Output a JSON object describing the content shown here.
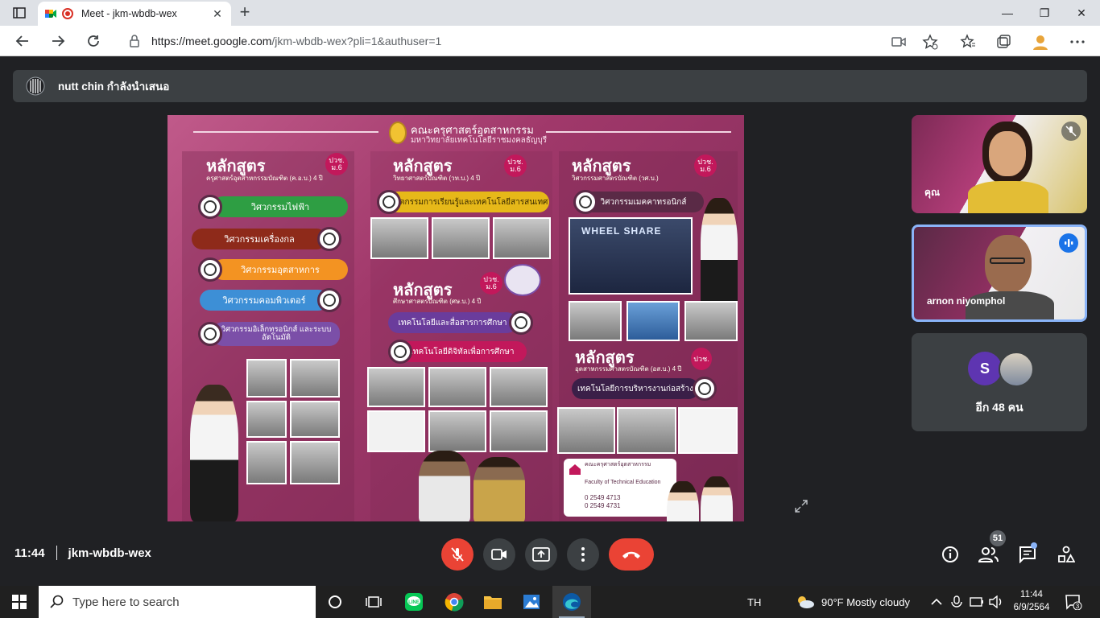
{
  "browser": {
    "tab_title": "Meet - jkm-wbdb-wex",
    "tab_close": "✕",
    "new_tab": "+",
    "url_host": "https://meet.google.com",
    "url_path": "/jkm-wbdb-wex?pli=1&authuser=1",
    "window_minimize": "—",
    "window_restore": "❐",
    "window_close": "✕"
  },
  "presenter": {
    "banner_text": "nutt chin กำลังนำเสนอ"
  },
  "slide": {
    "header_title": "คณะครุศาสตร์อุตสาหกรรม",
    "header_subtitle": "มหาวิทยาลัยเทคโนโลยีราชมงคลธัญบุรี",
    "columns": [
      {
        "heading": "หลักสูตร",
        "subtitle": "ครุศาสตร์อุตสาหกรรมบัณฑิต (ค.อ.บ.) 4 ปี",
        "badge": "ปวช. ม.6",
        "programs": [
          "วิศวกรรมไฟฟ้า",
          "วิศวกรรมเครื่องกล",
          "วิศวกรรมอุตสาหการ",
          "วิศวกรรมคอมพิวเตอร์",
          "วิศวกรรมอิเล็กทรอนิกส์ และระบบอัตโนมัติ"
        ]
      },
      {
        "heading": "หลักสูตร",
        "subtitle": "วิทยาศาสตร์บัณฑิต (วท.บ.) 4 ปี",
        "badge": "ปวช. ม.6",
        "programs": [
          "นวัตกรรมการเรียนรู้และเทคโนโลยีสารสนเทศ"
        ],
        "heading2": "หลักสูตร",
        "subtitle2": "ศึกษาศาสตรบัณฑิต (ศษ.บ.) 4 ปี",
        "badge2": "ปวช. ม.6",
        "programs2": [
          "เทคโนโลยีและสื่อสารการศึกษา",
          "เทคโนโลยีดิจิทัลเพื่อการศึกษา"
        ]
      },
      {
        "heading": "หลักสูตร",
        "subtitle": "วิศวกรรมศาสตรบัณฑิต (วศ.บ.)",
        "badge": "ปวช. ม.6",
        "programs": [
          "วิศวกรรมเมคคาทรอนิกส์"
        ],
        "wheel_share": "WHEEL SHARE",
        "heading2": "หลักสูตร",
        "subtitle2": "อุตสาหกรรมศาสตรบัณฑิต (อส.บ.) 4 ปี",
        "badge2": "ปวช.",
        "programs2": [
          "เทคโนโลยีการบริหารงานก่อสร้าง"
        ],
        "contact_faculty": "คณะครุศาสตร์อุตสาหกรรม",
        "contact_en": "Faculty of Technical Education",
        "phone1": "0 2549 4713",
        "phone2": "0 2549 4731"
      }
    ]
  },
  "tiles": [
    {
      "name": "คุณ",
      "mic": "muted"
    },
    {
      "name": "arnon niyomphol",
      "mic": "speaking"
    }
  ],
  "others": {
    "avatar_letter": "S",
    "label": "อีก 48 คน"
  },
  "meeting": {
    "time": "11:44",
    "code": "jkm-wbdb-wex",
    "participants_count": "51"
  },
  "taskbar": {
    "search_placeholder": "Type here to search",
    "language": "TH",
    "weather": "90°F  Mostly cloudy",
    "clock_time": "11:44",
    "clock_date": "6/9/2564",
    "notifications": "3"
  },
  "colors": {
    "meet_bg": "#202124",
    "tile_bg": "#3c4043",
    "end_call": "#ea4335",
    "accent_blue": "#8ab4f8",
    "slide_magenta": "#a0386a"
  }
}
